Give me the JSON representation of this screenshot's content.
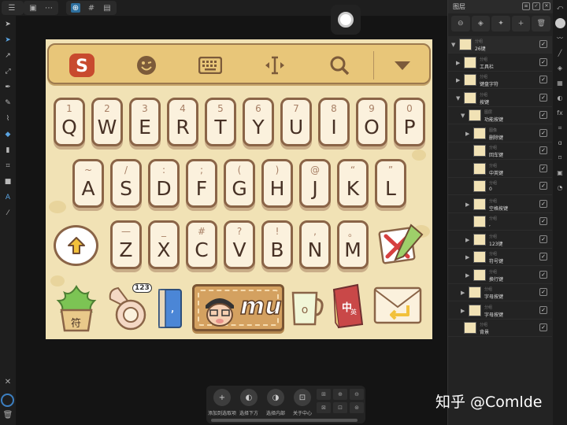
{
  "topbar": {
    "icons": [
      "document-icon",
      "more-icon",
      "snapping-icon",
      "grid-icon",
      "layout-icon"
    ]
  },
  "left_tools": [
    "move-tool-icon",
    "node-tool-icon",
    "corner-tool-icon",
    "point-transform-icon",
    "pen-icon",
    "pencil-icon",
    "vector-brush-icon",
    "fill-icon",
    "transparency-icon",
    "crop-icon",
    "shape-icon",
    "text-icon",
    "color-picker-icon"
  ],
  "keyboard": {
    "toolbar_icons": [
      "sogou-logo-icon",
      "emoji-icon",
      "keyboard-icon",
      "cursor-move-icon",
      "search-icon",
      "collapse-icon"
    ],
    "row1": [
      {
        "num": "1",
        "letter": "Q"
      },
      {
        "num": "2",
        "letter": "W"
      },
      {
        "num": "3",
        "letter": "E"
      },
      {
        "num": "4",
        "letter": "R"
      },
      {
        "num": "5",
        "letter": "T"
      },
      {
        "num": "6",
        "letter": "Y"
      },
      {
        "num": "7",
        "letter": "U"
      },
      {
        "num": "8",
        "letter": "I"
      },
      {
        "num": "9",
        "letter": "O"
      },
      {
        "num": "0",
        "letter": "P"
      }
    ],
    "row2": [
      {
        "num": "~",
        "letter": "A"
      },
      {
        "num": "/",
        "letter": "S"
      },
      {
        "num": ":",
        "letter": "D"
      },
      {
        "num": ";",
        "letter": "F"
      },
      {
        "num": "(",
        "letter": "G"
      },
      {
        "num": ")",
        "letter": "H"
      },
      {
        "num": "@",
        "letter": "J"
      },
      {
        "num": "“",
        "letter": "K"
      },
      {
        "num": "”",
        "letter": "L"
      }
    ],
    "row3": [
      {
        "num": "—",
        "letter": "Z"
      },
      {
        "num": "_",
        "letter": "X"
      },
      {
        "num": "#",
        "letter": "C"
      },
      {
        "num": "?",
        "letter": "V"
      },
      {
        "num": "!",
        "letter": "B"
      },
      {
        "num": ",",
        "letter": "N"
      },
      {
        "num": "。",
        "letter": "M"
      }
    ],
    "plant_label": "符",
    "phone_badge": "123",
    "mu_label": "mu",
    "book_label": "中",
    "book_sub": "英"
  },
  "layers_panel": {
    "title": "图层",
    "buttons": [
      "mask-icon",
      "layers-icon",
      "fx-icon",
      "add-icon",
      "delete-icon"
    ],
    "items": [
      {
        "sub": "分组",
        "name": "26键",
        "checked": true
      },
      {
        "sub": "分组",
        "name": "工具栏",
        "checked": true
      },
      {
        "sub": "分组",
        "name": "键盘字符",
        "checked": true
      },
      {
        "sub": "分组",
        "name": "按键",
        "checked": true
      },
      {
        "sub": "图层",
        "name": "功能按键",
        "checked": true
      },
      {
        "sub": "图像",
        "name": "删除键",
        "checked": true
      },
      {
        "sub": "分组",
        "name": "回车键",
        "checked": true
      },
      {
        "sub": "分组",
        "name": "中英键",
        "checked": true
      },
      {
        "sub": "分组",
        "name": "0",
        "checked": true
      },
      {
        "sub": "分组",
        "name": "空格按键",
        "checked": true
      },
      {
        "sub": "分组",
        "name": ",",
        "checked": true
      },
      {
        "sub": "分组",
        "name": "123键",
        "checked": true
      },
      {
        "sub": "分组",
        "name": "符号键",
        "checked": true
      },
      {
        "sub": "分组",
        "name": "换行键",
        "checked": true
      },
      {
        "sub": "分组",
        "name": "字母按键",
        "checked": true
      },
      {
        "sub": "分组",
        "name": "字母按键",
        "checked": true
      },
      {
        "sub": "分组",
        "name": "背景",
        "checked": true
      }
    ]
  },
  "right_strip_icons": [
    "color-icon",
    "brush-icon",
    "pen-style-icon",
    "layers-tab-icon",
    "effects-icon",
    "adjust-icon",
    "styles-icon",
    "transform-icon",
    "text-style-icon",
    "glyph-icon",
    "navigator-icon",
    "history-icon"
  ],
  "context_bar": {
    "buttons": [
      {
        "icon": "+",
        "label": "添加到选取项"
      },
      {
        "icon": "◐",
        "label": "选择下方"
      },
      {
        "icon": "◑",
        "label": "选择内部"
      },
      {
        "icon": "⊡",
        "label": "关于中心"
      }
    ],
    "grid": [
      "⊞",
      "⊕",
      "⊖",
      "⊠",
      "⊡",
      "⊛"
    ]
  },
  "watermark": "知乎 @Comlde",
  "colors": {
    "artboard": "#f1e2b5",
    "key_border": "#8a6447",
    "accent": "#2d6f9e"
  }
}
